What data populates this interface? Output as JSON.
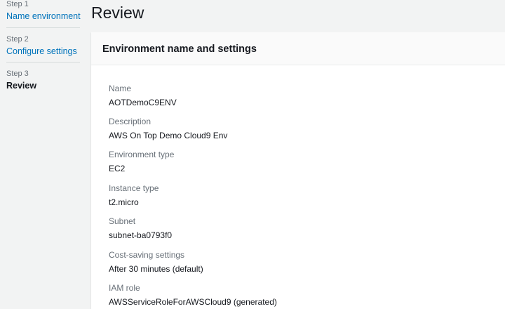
{
  "steps": [
    {
      "caption": "Step 1",
      "title": "Name environment"
    },
    {
      "caption": "Step 2",
      "title": "Configure settings"
    },
    {
      "caption": "Step 3",
      "title": "Review"
    }
  ],
  "page": {
    "title": "Review"
  },
  "panel": {
    "title": "Environment name and settings",
    "fields": [
      {
        "label": "Name",
        "value": "AOTDemoC9ENV"
      },
      {
        "label": "Description",
        "value": "AWS On Top Demo Cloud9 Env"
      },
      {
        "label": "Environment type",
        "value": "EC2"
      },
      {
        "label": "Instance type",
        "value": "t2.micro"
      },
      {
        "label": "Subnet",
        "value": "subnet-ba0793f0"
      },
      {
        "label": "Cost-saving settings",
        "value": "After 30 minutes (default)"
      },
      {
        "label": "IAM role",
        "value": "AWSServiceRoleForAWSCloud9 (generated)"
      }
    ]
  },
  "colors": {
    "link": "#0073bb",
    "text": "#16191f",
    "muted": "#687078",
    "background": "#f2f3f3"
  }
}
